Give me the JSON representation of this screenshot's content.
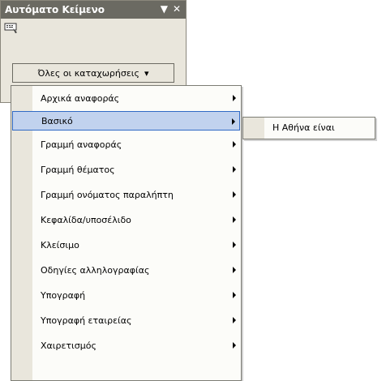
{
  "pane": {
    "title": "Αυτόματο Κείμενο",
    "dropdown_label": "Όλες οι καταχωρήσεις",
    "dropdown_arrow": "▾"
  },
  "menu": {
    "items": [
      {
        "label": "Αρχικά αναφοράς"
      },
      {
        "label": "Βασικό",
        "active": true
      },
      {
        "label": "Γραμμή αναφοράς"
      },
      {
        "label": "Γραμμή θέματος"
      },
      {
        "label": "Γραμμή ονόματος παραλήπτη"
      },
      {
        "label": "Κεφαλίδα/υποσέλιδο"
      },
      {
        "label": "Κλείσιμο"
      },
      {
        "label": "Οδηγίες αλληλογραφίας"
      },
      {
        "label": "Υπογραφή"
      },
      {
        "label": "Υπογραφή εταιρείας"
      },
      {
        "label": "Χαιρετισμός"
      }
    ]
  },
  "submenu": {
    "items": [
      {
        "label": "Η Αθήνα είναι"
      }
    ]
  },
  "colors": {
    "title_bar": "#6b6a62",
    "pane_bg": "#e9e6dc",
    "highlight_bg": "#c1d2ee",
    "highlight_border": "#316ac5"
  }
}
